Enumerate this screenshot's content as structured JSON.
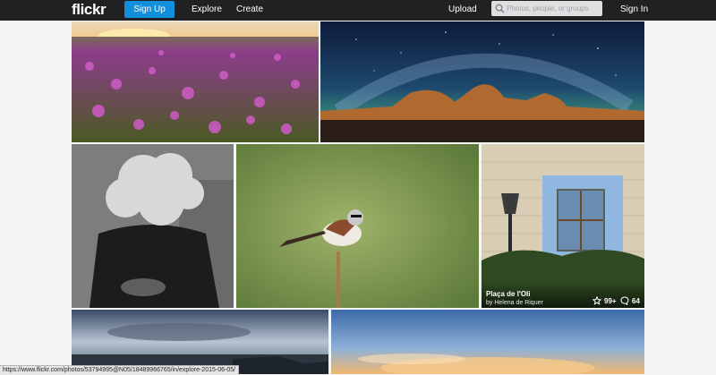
{
  "header": {
    "logo": "flickr",
    "signup_label": "Sign Up",
    "explore_label": "Explore",
    "create_label": "Create",
    "upload_label": "Upload",
    "search_placeholder": "Photos, people, or groups",
    "signin_label": "Sign In"
  },
  "photos": [
    {
      "subject": "purple wildflower field at sunset"
    },
    {
      "subject": "milky way over desert rocks"
    },
    {
      "subject": "smoke covering man's head"
    },
    {
      "subject": "bird perched on stalk"
    },
    {
      "subject": "window in stone wall with street lamp",
      "title": "Plaça de l'Oli",
      "author": "by Helena de Riquer",
      "faves": "99+",
      "comments": "64"
    },
    {
      "subject": "stormy seascape"
    },
    {
      "subject": "sunset clouds"
    }
  ],
  "status_url": "https://www.flickr.com/photos/53794995@N05/18489966765/in/explore-2015-06-05/",
  "colors": {
    "header_bg": "#212124",
    "accent": "#128fdc",
    "page_bg": "#f3f5f6"
  }
}
